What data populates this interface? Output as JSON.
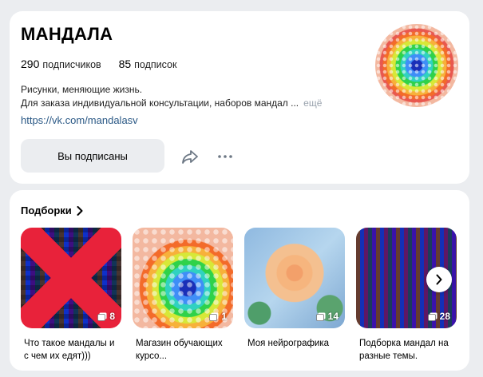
{
  "profile": {
    "title": "МАНДАЛА",
    "subscribers_count": "290",
    "subscribers_label": "подписчиков",
    "subscriptions_count": "85",
    "subscriptions_label": "подписок",
    "description_line1": "Рисунки, меняющие жизнь.",
    "description_line2": "Для заказа индивидуальной консультации, наборов мандал ...",
    "more_label": "ещё",
    "link": "https://vk.com/mandalasv",
    "subscribed_button": "Вы подписаны",
    "icons": {
      "share": "share-icon",
      "more": "more-dots-icon"
    }
  },
  "collections": {
    "header": "Подборки",
    "items": [
      {
        "caption": "Что такое мандалы и с чем их едят)))",
        "count": "8"
      },
      {
        "caption": "Магазин обучающих курсо...",
        "count": "1"
      },
      {
        "caption": "Моя нейрографика",
        "count": "14"
      },
      {
        "caption": "Подборка мандал на разные темы.",
        "count": "28"
      }
    ],
    "colors": {
      "background": "#ebedf0",
      "link": "#2a5885",
      "muted": "#99a2ad"
    }
  }
}
